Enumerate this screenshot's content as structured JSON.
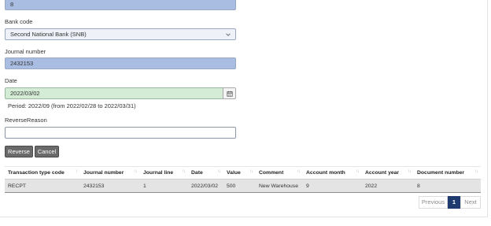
{
  "form": {
    "document_number_value": "8",
    "bank_code": {
      "label": "Bank code",
      "selected": "Second National Bank (SNB)"
    },
    "journal_number": {
      "label": "Journal number",
      "value": "2432153"
    },
    "date": {
      "label": "Date",
      "value": "2022/03/02",
      "icon": "calendar-icon"
    },
    "period_text": "Period: 2022/09 (from 2022/02/28 to 2022/03/31)",
    "reverse_reason": {
      "label": "ReverseReason",
      "value": ""
    }
  },
  "buttons": {
    "reverse": "Reverse",
    "cancel": "Cancel"
  },
  "table": {
    "headers": [
      "Transaction type code",
      "Journal number",
      "Journal line",
      "Date",
      "Value",
      "Comment",
      "Account month",
      "Account year",
      "Document number"
    ],
    "rows": [
      [
        "RECPT",
        "2432153",
        "1",
        "2022/03/02",
        "500",
        "New Warehouse",
        "9",
        "2022",
        "8"
      ]
    ]
  },
  "pagination": {
    "previous": "Previous",
    "current": "1",
    "next": "Next"
  },
  "colors": {
    "readonly_field": "#a9bde2",
    "date_field": "#d4ecd6",
    "button": "#6a6a6a",
    "active_page": "#1e3a6e"
  }
}
